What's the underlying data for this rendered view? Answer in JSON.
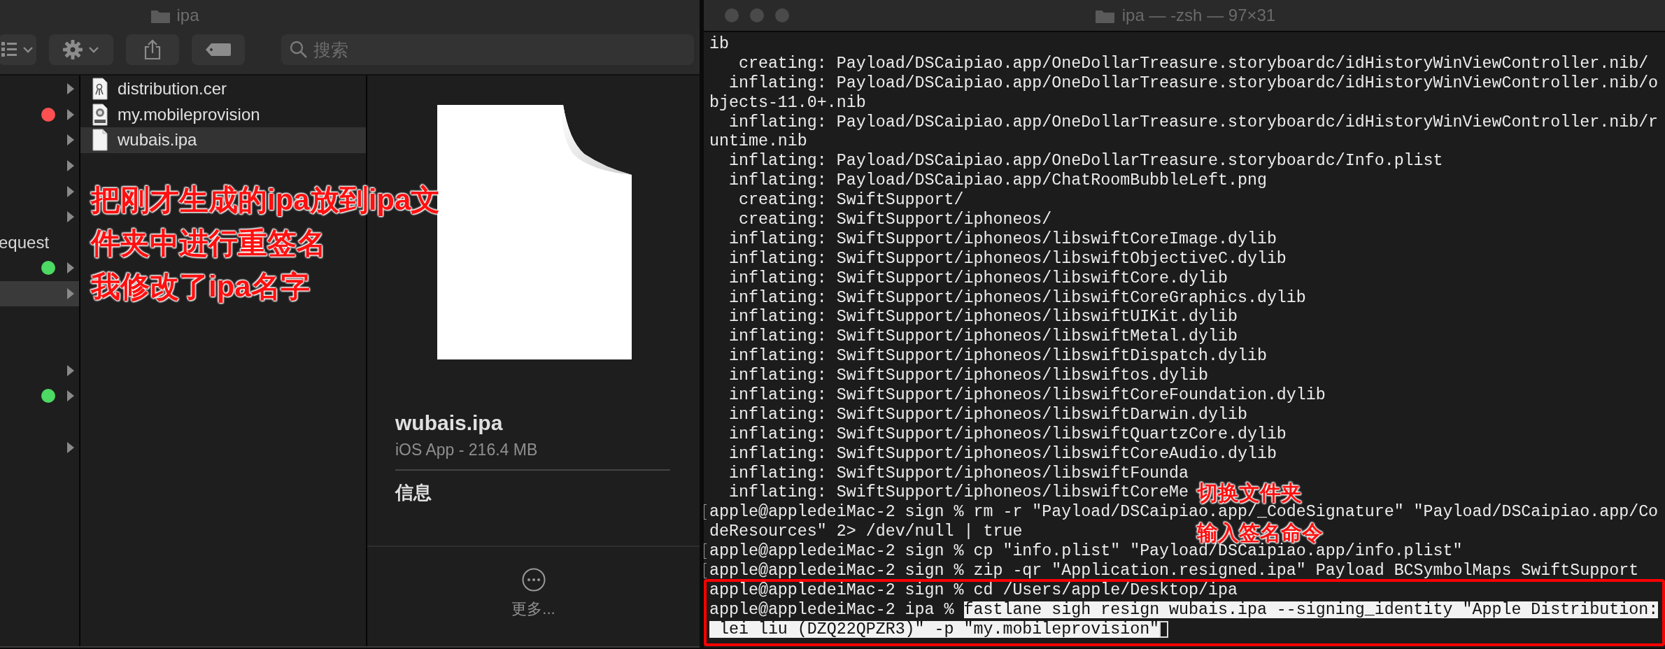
{
  "finder": {
    "title": "ipa",
    "search": {
      "placeholder": "搜索"
    },
    "sidebar": [
      {
        "disclosure": true,
        "selected": false
      },
      {
        "color": "#fe5050",
        "disclosure": true,
        "selected": false
      },
      {
        "disclosure": true,
        "selected": false
      },
      {
        "disclosure": true,
        "selected": false
      },
      {
        "disclosure": true,
        "selected": false
      },
      {
        "disclosure": true,
        "selected": false
      },
      {
        "label": "equest",
        "disclosure": false,
        "selected": false
      },
      {
        "color": "#4cd964",
        "disclosure": true,
        "selected": false
      },
      {
        "disclosure": true,
        "selected": true
      },
      {
        "disclosure": false,
        "selected": false
      },
      {
        "disclosure": false,
        "selected": false
      },
      {
        "disclosure": true,
        "selected": false
      },
      {
        "color": "#4cd964",
        "disclosure": true,
        "selected": false
      },
      {
        "disclosure": false,
        "selected": false
      },
      {
        "disclosure": true,
        "selected": false
      }
    ],
    "files": [
      {
        "name": "distribution.cer",
        "kind": "certificate",
        "selected": false
      },
      {
        "name": "my.mobileprovision",
        "kind": "provision",
        "selected": false
      },
      {
        "name": "wubais.ipa",
        "kind": "document",
        "selected": true
      }
    ],
    "preview": {
      "name": "wubais.ipa",
      "subtitle": "iOS App - 216.4 MB",
      "section": "信息",
      "more": "更多..."
    },
    "annotation": [
      "把刚才生成的ipa放到ipa文",
      "件夹中进行重签名",
      "我修改了ipa名字"
    ]
  },
  "terminal": {
    "title": "ipa — -zsh — 97×31",
    "lines": [
      {
        "text": "ib"
      },
      {
        "text": "   creating: Payload/DSCaipiao.app/OneDollarTreasure.storyboardc/idHistoryWinViewController.nib/"
      },
      {
        "text": "  inflating: Payload/DSCaipiao.app/OneDollarTreasure.storyboardc/idHistoryWinViewController.nib/o"
      },
      {
        "text": "bjects-11.0+.nib"
      },
      {
        "text": "  inflating: Payload/DSCaipiao.app/OneDollarTreasure.storyboardc/idHistoryWinViewController.nib/r"
      },
      {
        "text": "untime.nib"
      },
      {
        "text": "  inflating: Payload/DSCaipiao.app/OneDollarTreasure.storyboardc/Info.plist"
      },
      {
        "text": "  inflating: Payload/DSCaipiao.app/ChatRoomBubbleLeft.png"
      },
      {
        "text": "   creating: SwiftSupport/"
      },
      {
        "text": "   creating: SwiftSupport/iphoneos/"
      },
      {
        "text": "  inflating: SwiftSupport/iphoneos/libswiftCoreImage.dylib"
      },
      {
        "text": "  inflating: SwiftSupport/iphoneos/libswiftObjectiveC.dylib"
      },
      {
        "text": "  inflating: SwiftSupport/iphoneos/libswiftCore.dylib"
      },
      {
        "text": "  inflating: SwiftSupport/iphoneos/libswiftCoreGraphics.dylib"
      },
      {
        "text": "  inflating: SwiftSupport/iphoneos/libswiftUIKit.dylib"
      },
      {
        "text": "  inflating: SwiftSupport/iphoneos/libswiftMetal.dylib"
      },
      {
        "text": "  inflating: SwiftSupport/iphoneos/libswiftDispatch.dylib"
      },
      {
        "text": "  inflating: SwiftSupport/iphoneos/libswiftos.dylib"
      },
      {
        "text": "  inflating: SwiftSupport/iphoneos/libswiftCoreFoundation.dylib"
      },
      {
        "text": "  inflating: SwiftSupport/iphoneos/libswiftDarwin.dylib"
      },
      {
        "text": "  inflating: SwiftSupport/iphoneos/libswiftQuartzCore.dylib"
      },
      {
        "text": "  inflating: SwiftSupport/iphoneos/libswiftCoreAudio.dylib"
      },
      {
        "text": "  inflating: SwiftSupport/iphoneos/libswiftFounda"
      },
      {
        "text": "  inflating: SwiftSupport/iphoneos/libswiftCoreMe"
      },
      {
        "text": "apple@appledeiMac-2 sign % rm -r \"Payload/DSCaipiao.app/_CodeSignature\" \"Payload/DSCaipiao.app/Co",
        "marked": true
      },
      {
        "text": "deResources\" 2> /dev/null | true"
      },
      {
        "text": "apple@appledeiMac-2 sign % cp \"info.plist\" \"Payload/DSCaipiao.app/info.plist\"",
        "marked": true
      },
      {
        "text": "apple@appledeiMac-2 sign % zip -qr \"Application.resigned.ipa\" Payload BCSymbolMaps SwiftSupport",
        "marked": true
      },
      {
        "text": "apple@appledeiMac-2 sign % cd /Users/apple/Desktop/ipa"
      },
      {
        "text": "apple@appledeiMac-2 ipa % ",
        "selection": "fastlane sigh resign wubais.ipa --signing_identity \"Apple Distribution:"
      },
      {
        "selection": " lei liu (DZQ22QPZR3)\" -p \"my.mobileprovision\"",
        "cursor": true
      }
    ],
    "annotation": [
      "切换文件夹",
      "输入签名命令"
    ]
  }
}
